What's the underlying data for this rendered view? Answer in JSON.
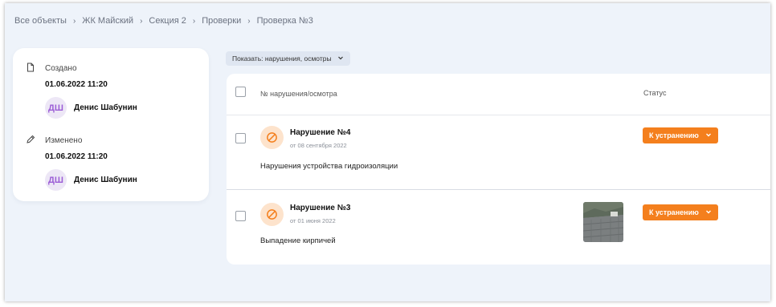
{
  "breadcrumb": [
    "Все объекты",
    "ЖК Майский",
    "Секция 2",
    "Проверки",
    "Проверка №3"
  ],
  "info": {
    "created_label": "Создано",
    "created_date": "01.06.2022 11:20",
    "created_user_initials": "ДШ",
    "created_user_name": "Денис Шабунин",
    "modified_label": "Изменено",
    "modified_date": "01.06.2022 11:20",
    "modified_user_initials": "ДШ",
    "modified_user_name": "Денис Шабунин"
  },
  "filter": {
    "label": "Показать: нарушения, осмотры"
  },
  "table": {
    "columns": [
      "№ нарушения/осмотра",
      "Статус"
    ],
    "rows": [
      {
        "title": "Нарушение №4",
        "date": "от 08 сентября 2022",
        "description": "Нарушения устройства гидроизоляции",
        "status": "К устранению",
        "has_photo": false
      },
      {
        "title": "Нарушение №3",
        "date": "от 01 июня 2022",
        "description": "Выпадение кирпичей",
        "status": "К устранению",
        "has_photo": true
      }
    ]
  },
  "colors": {
    "status": "#f47f1d",
    "violation_icon_bg": "#fde3cc",
    "violation_icon": "#f47f1d",
    "avatar_bg": "#ede7f6",
    "avatar_text": "#9c5dd6",
    "page_bg": "#eef3fa"
  },
  "icons": {
    "created": "document-icon",
    "modified": "pencil-icon",
    "violation": "prohibited-icon",
    "chevron": "chevron-down-icon",
    "separator": "chevron-right-icon"
  }
}
